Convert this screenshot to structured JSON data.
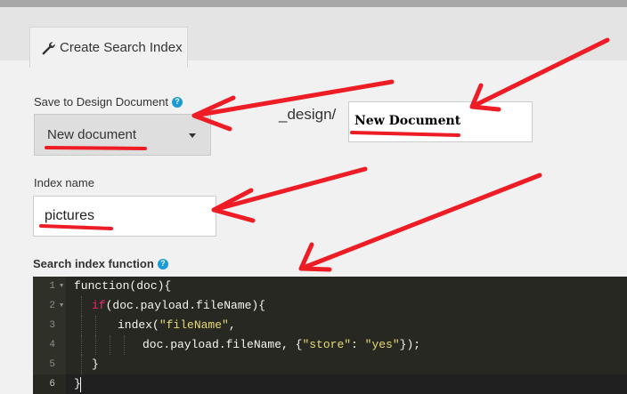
{
  "tabs": [
    {
      "label": "Create Search Index",
      "icon": "wrench-icon"
    }
  ],
  "design_doc": {
    "label": "Save to Design Document",
    "selected": "New document",
    "prefix": "_design/",
    "name_value": "New Document"
  },
  "index_name": {
    "label": "Index name",
    "value": "pictures"
  },
  "search_function": {
    "label": "Search index function",
    "line_numbers": [
      "1",
      "2",
      "3",
      "4",
      "5",
      "6"
    ],
    "code_lines": [
      "function(doc){",
      "if(doc.payload.fileName){",
      "index(\"fileName\",",
      "doc.payload.fileName, {\"store\": \"yes\"});",
      "}",
      "}"
    ]
  },
  "colors": {
    "annotation": "#ee1c25",
    "help_icon": "#1a9bd7",
    "editor_bg": "#272822",
    "keyword": "#f92672",
    "string": "#e6db74"
  }
}
